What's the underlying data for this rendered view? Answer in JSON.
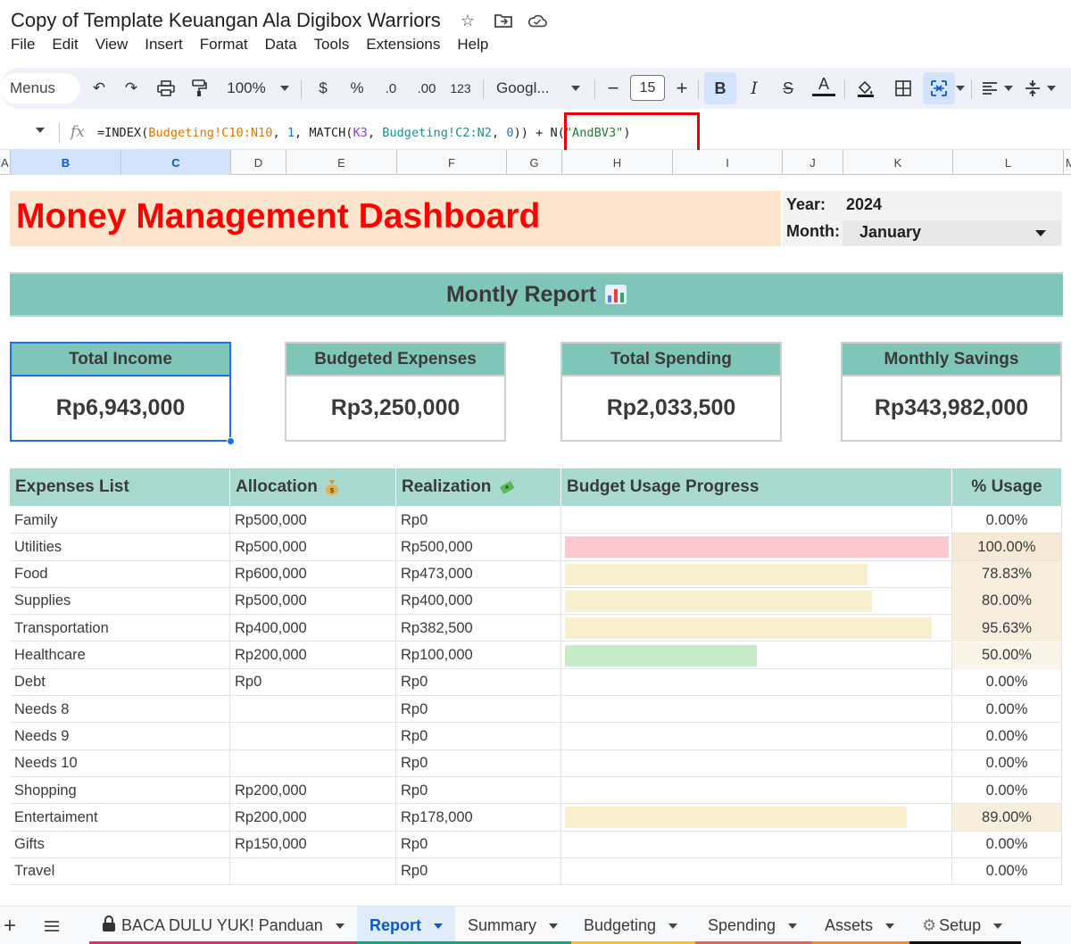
{
  "window": {
    "doc_title": "Copy of Template Keuangan Ala Digibox Warriors",
    "title_icons": [
      "star-icon",
      "move-to-folder-icon",
      "cloud-status-icon"
    ]
  },
  "menubar": [
    "File",
    "Edit",
    "View",
    "Insert",
    "Format",
    "Data",
    "Tools",
    "Extensions",
    "Help"
  ],
  "toolbar": {
    "menus_label": "Menus",
    "zoom": "100%",
    "currency": "$",
    "percent": "%",
    "decrease_decimal": ".0",
    "increase_decimal": ".00",
    "number_format": "123",
    "font": "Googl...",
    "font_size": "15",
    "bold": "B",
    "italic": "I",
    "strike": "S",
    "text_color": "A"
  },
  "formula": {
    "fx": "fx",
    "parts": [
      {
        "t": "=INDEX(",
        "c": ""
      },
      {
        "t": "Budgeting!C10:N10",
        "c": "orange"
      },
      {
        "t": ", ",
        "c": ""
      },
      {
        "t": "1",
        "c": "blue"
      },
      {
        "t": ", MATCH(",
        "c": ""
      },
      {
        "t": "K3",
        "c": "purple"
      },
      {
        "t": ", ",
        "c": ""
      },
      {
        "t": "Budgeting!C2:N2",
        "c": "teal"
      },
      {
        "t": ", ",
        "c": ""
      },
      {
        "t": "0",
        "c": "blue"
      },
      {
        "t": ")) + N(",
        "c": ""
      },
      {
        "t": "\"AndBV3\"",
        "c": "green"
      },
      {
        "t": ")",
        "c": ""
      }
    ]
  },
  "columns": [
    "A",
    "B",
    "C",
    "D",
    "E",
    "F",
    "G",
    "H",
    "I",
    "J",
    "K",
    "L",
    "M"
  ],
  "dashboard": {
    "title": "Money Management Dashboard",
    "year_label": "Year:",
    "year": "2024",
    "month_label": "Month:",
    "month": "January",
    "report_title": "Montly Report"
  },
  "cards": [
    {
      "label": "Total Income",
      "value": "Rp6,943,000"
    },
    {
      "label": "Budgeted Expenses",
      "value": "Rp3,250,000"
    },
    {
      "label": "Total Spending",
      "value": "Rp2,033,500"
    },
    {
      "label": "Monthly Savings",
      "value": "Rp343,982,000"
    }
  ],
  "table": {
    "headers": {
      "name": "Expenses List",
      "alloc": "Allocation",
      "real": "Realization",
      "progress": "Budget Usage Progress",
      "pct": "% Usage"
    },
    "header_icons": {
      "alloc": "money-bag-icon",
      "real": "money-with-wings-icon"
    },
    "rows": [
      {
        "name": "Family",
        "alloc": "Rp500,000",
        "real": "Rp0",
        "pct": "0.00%",
        "usage": 0.0
      },
      {
        "name": "Utilities",
        "alloc": "Rp500,000",
        "real": "Rp500,000",
        "pct": "100.00%",
        "usage": 1.0
      },
      {
        "name": "Food",
        "alloc": "Rp600,000",
        "real": "Rp473,000",
        "pct": "78.83%",
        "usage": 0.7883
      },
      {
        "name": "Supplies",
        "alloc": "Rp500,000",
        "real": "Rp400,000",
        "pct": "80.00%",
        "usage": 0.8
      },
      {
        "name": "Transportation",
        "alloc": "Rp400,000",
        "real": "Rp382,500",
        "pct": "95.63%",
        "usage": 0.9563
      },
      {
        "name": "Healthcare",
        "alloc": "Rp200,000",
        "real": "Rp100,000",
        "pct": "50.00%",
        "usage": 0.5
      },
      {
        "name": "Debt",
        "alloc": "Rp0",
        "real": "Rp0",
        "pct": "0.00%",
        "usage": 0.0
      },
      {
        "name": "Needs 8",
        "alloc": "",
        "real": "Rp0",
        "pct": "0.00%",
        "usage": 0.0
      },
      {
        "name": "Needs 9",
        "alloc": "",
        "real": "Rp0",
        "pct": "0.00%",
        "usage": 0.0
      },
      {
        "name": "Needs 10",
        "alloc": "",
        "real": "Rp0",
        "pct": "0.00%",
        "usage": 0.0
      },
      {
        "name": "Shopping",
        "alloc": "Rp200,000",
        "real": "Rp0",
        "pct": "0.00%",
        "usage": 0.0
      },
      {
        "name": "Entertaiment",
        "alloc": "Rp200,000",
        "real": "Rp178,000",
        "pct": "89.00%",
        "usage": 0.89
      },
      {
        "name": "Gifts",
        "alloc": "Rp150,000",
        "real": "Rp0",
        "pct": "0.00%",
        "usage": 0.0
      },
      {
        "name": "Travel",
        "alloc": "",
        "real": "Rp0",
        "pct": "0.00%",
        "usage": 0.0
      }
    ],
    "bar_colors": {
      "full": "#fbc8d0",
      "high": "#f7efcd",
      "mid": "#c7ebc8"
    },
    "pct_bg_colors": {
      "full": "#f6ead6",
      "high": "#f7eedd",
      "mid": "#faf5e8"
    }
  },
  "tabs": [
    {
      "label": "BACA DULU YUK! Panduan",
      "icon": "lock-icon",
      "strip": "#d6336c"
    },
    {
      "label": "Report",
      "strip": "#1aa37a",
      "active": true
    },
    {
      "label": "Summary",
      "strip": "#1aa37a"
    },
    {
      "label": "Budgeting",
      "strip": "#f1c232"
    },
    {
      "label": "Spending",
      "strip": "#e06666"
    },
    {
      "label": "Assets",
      "strip": "#e69138"
    },
    {
      "label": "Setup",
      "icon": "gear-icon",
      "strip": "#111111"
    }
  ]
}
